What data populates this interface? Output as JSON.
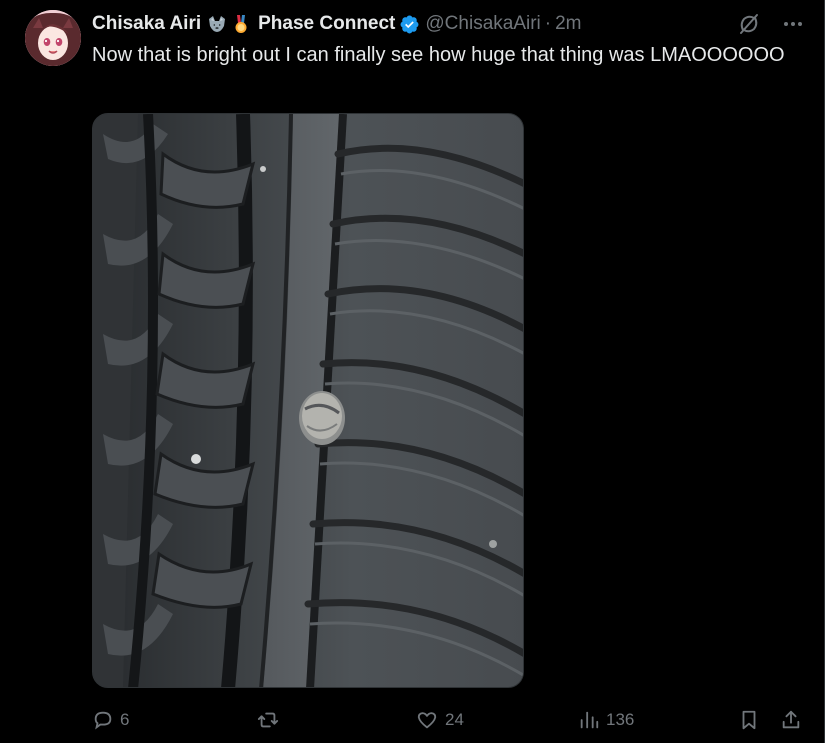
{
  "tweet": {
    "display_name": "Chisaka Airi",
    "name_emojis": [
      "wolf-emoji",
      "medal-emoji"
    ],
    "affiliation": "Phase Connect",
    "verified": true,
    "handle": "@ChisakaAiri",
    "separator": "·",
    "time": "2m",
    "text": "Now that is bright out I can finally see how huge that thing was LMAOOOOOO",
    "media": {
      "icon": "tire-with-screw-photo"
    }
  },
  "top_actions": {
    "grok_icon": "grok-icon",
    "more_icon": "more-icon"
  },
  "actions": {
    "replies": "6",
    "reposts": "",
    "likes": "24",
    "views": "136"
  },
  "colors": {
    "background": "#000000",
    "text": "#e7e9ea",
    "muted": "#71767b",
    "verified": "#1d9bf0",
    "border": "#2f3336"
  }
}
